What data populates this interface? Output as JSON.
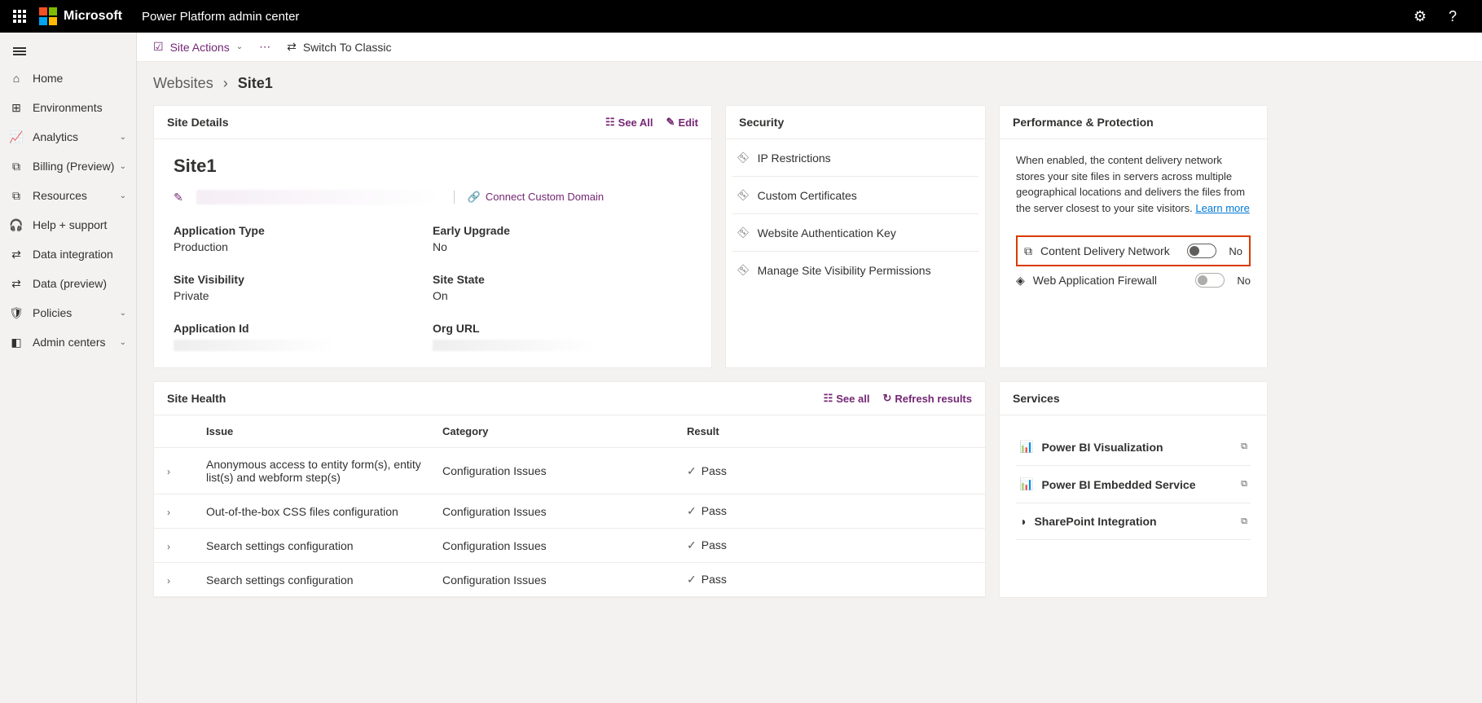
{
  "topbar": {
    "ms": "Microsoft",
    "app": "Power Platform admin center"
  },
  "nav": {
    "items": [
      {
        "label": "Home"
      },
      {
        "label": "Environments"
      },
      {
        "label": "Analytics",
        "expand": true
      },
      {
        "label": "Billing (Preview)",
        "expand": true
      },
      {
        "label": "Resources",
        "expand": true
      },
      {
        "label": "Help + support"
      },
      {
        "label": "Data integration"
      },
      {
        "label": "Data (preview)"
      },
      {
        "label": "Policies",
        "expand": true
      },
      {
        "label": "Admin centers",
        "expand": true
      }
    ]
  },
  "cmd": {
    "siteActions": "Site Actions",
    "switch": "Switch To Classic"
  },
  "breadcrumb": {
    "parent": "Websites",
    "current": "Site1"
  },
  "details": {
    "header": "Site Details",
    "seeAll": "See All",
    "edit": "Edit",
    "siteName": "Site1",
    "connectDomain": "Connect Custom Domain",
    "fields": {
      "appTypeLabel": "Application Type",
      "appType": "Production",
      "earlyLabel": "Early Upgrade",
      "early": "No",
      "visLabel": "Site Visibility",
      "vis": "Private",
      "stateLabel": "Site State",
      "state": "On",
      "appIdLabel": "Application Id",
      "orgUrlLabel": "Org URL"
    }
  },
  "security": {
    "header": "Security",
    "items": [
      "IP Restrictions",
      "Custom Certificates",
      "Website Authentication Key",
      "Manage Site Visibility Permissions"
    ]
  },
  "perf": {
    "header": "Performance & Protection",
    "desc": "When enabled, the content delivery network stores your site files in servers across multiple geographical locations and delivers the files from the server closest to your site visitors. ",
    "learn": "Learn more",
    "cdn": "Content Delivery Network",
    "waf": "Web Application Firewall",
    "no": "No"
  },
  "health": {
    "header": "Site Health",
    "seeAll": "See all",
    "refresh": "Refresh results",
    "cols": {
      "issue": "Issue",
      "category": "Category",
      "result": "Result"
    },
    "rows": [
      {
        "issue": "Anonymous access to entity form(s), entity list(s) and webform step(s)",
        "cat": "Configuration Issues",
        "result": "Pass"
      },
      {
        "issue": "Out-of-the-box CSS files configuration",
        "cat": "Configuration Issues",
        "result": "Pass"
      },
      {
        "issue": "Search settings configuration",
        "cat": "Configuration Issues",
        "result": "Pass"
      },
      {
        "issue": "Search settings configuration",
        "cat": "Configuration Issues",
        "result": "Pass"
      }
    ]
  },
  "services": {
    "header": "Services",
    "items": [
      "Power BI Visualization",
      "Power BI Embedded Service",
      "SharePoint Integration"
    ]
  }
}
